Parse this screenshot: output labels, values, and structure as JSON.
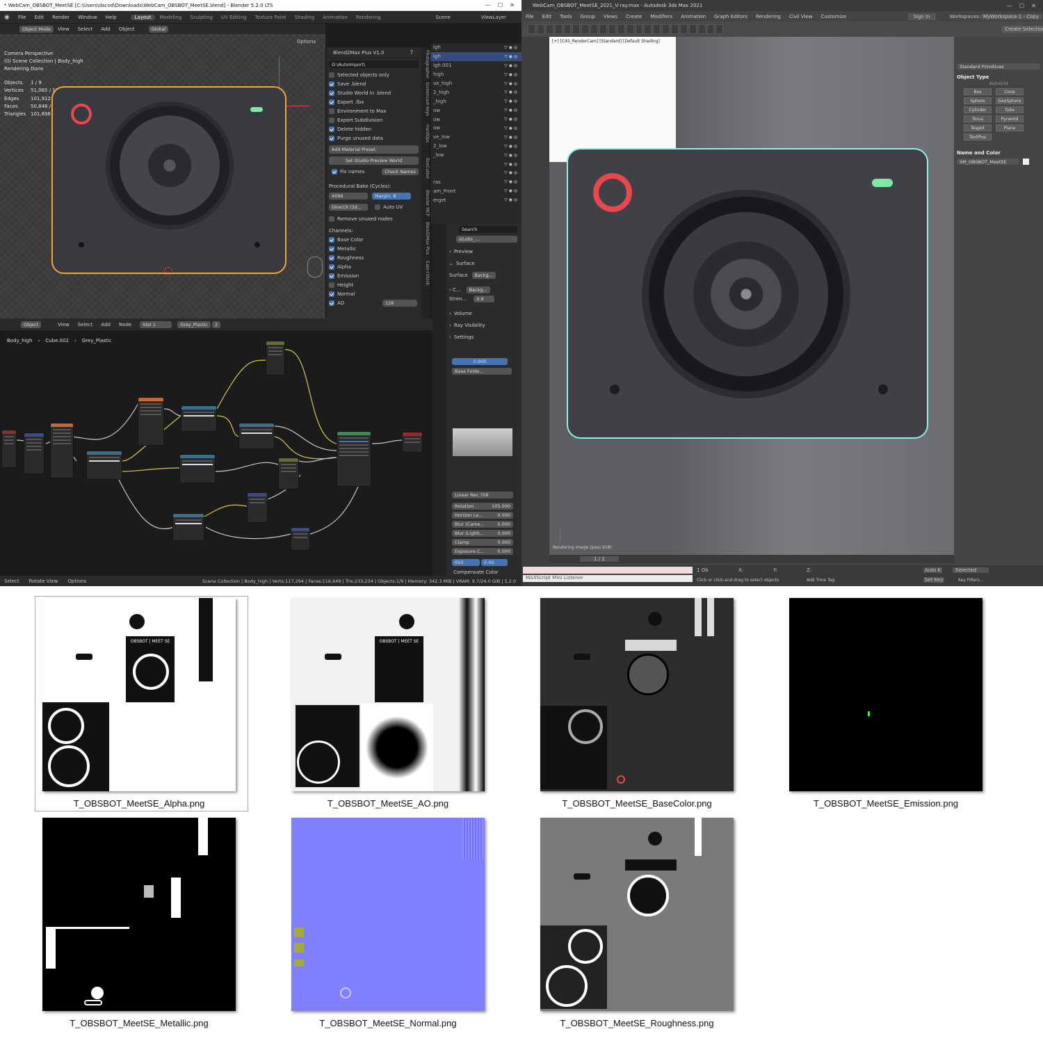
{
  "blender": {
    "title": "* WebCam_OBSBOT_MeetSE [C:\\Users\\dacod\\Downloads\\WebCam_OBSBOT_MeetSE.blend] - Blender 5.2.0 LTS",
    "menu": [
      "File",
      "Edit",
      "Render",
      "Window",
      "Help"
    ],
    "workspaces": [
      "Layout",
      "Modeling",
      "Sculpting",
      "UV Editing",
      "Texture Paint",
      "Shading",
      "Animation",
      "Rendering"
    ],
    "active_workspace": "Layout",
    "scene": "Scene",
    "view_layer": "ViewLayer",
    "header": {
      "mode": "Object Mode",
      "view": "View",
      "select": "Select",
      "add": "Add",
      "object": "Object",
      "orientation": "Global",
      "options": "Options"
    },
    "overlay": {
      "cam": "Camera Perspective",
      "collection": "(0) Scene Collection | Body_high",
      "status": "Rendering Done"
    },
    "stats": [
      {
        "k": "Objects",
        "v": "1 / 9"
      },
      {
        "k": "Vertices",
        "v": "51,065 / 117,294"
      },
      {
        "k": "Edges",
        "v": "101,912 / 233,919"
      },
      {
        "k": "Faces",
        "v": "50,848 / 116,649"
      },
      {
        "k": "Triangles",
        "v": "101,696 / 233,234"
      }
    ],
    "addon": {
      "title": "Blend2Max Plus V1.0",
      "path": "D:\\AutoImport\\",
      "options": [
        {
          "l": "Selected objects only",
          "c": false
        },
        {
          "l": "Save .blend",
          "c": true
        },
        {
          "l": "Studio World in .blend",
          "c": true
        },
        {
          "l": "Export .fbx",
          "c": true
        },
        {
          "l": "Environment to Max",
          "c": false
        },
        {
          "l": "Export Subdivision",
          "c": false
        },
        {
          "l": "Delete hidden",
          "c": true
        },
        {
          "l": "Purge unused data",
          "c": true
        }
      ],
      "add_preset": "Add Material Preset",
      "studio_btn": "Set Studio Preview World",
      "fix_names": "Fix names",
      "check_names": "Check Names",
      "bake_title": "Procedural Bake (Cycles):",
      "res": "4096",
      "margin_label": "Margin",
      "margin": "8",
      "normal_fmt": "DirectX (3d...",
      "auto_uv": "Auto UV",
      "remove_nodes": "Remove unused nodes",
      "channels_title": "Channels:",
      "channels": [
        {
          "l": "Base Color",
          "c": true
        },
        {
          "l": "Metallic",
          "c": true
        },
        {
          "l": "Roughness",
          "c": true
        },
        {
          "l": "Alpha",
          "c": true
        },
        {
          "l": "Emission",
          "c": true
        },
        {
          "l": "Height",
          "c": false
        },
        {
          "l": "Normal",
          "c": true
        },
        {
          "l": "AO",
          "c": true
        }
      ],
      "ao_samples": "128"
    },
    "side_tabs": [
      "Photographer",
      "Screencast Keys",
      "HardOps",
      "BoxCutter",
      "Blender MCP",
      "Blend2Max Plus",
      "Cam+Stock"
    ],
    "outliner": [
      "igh",
      "igh",
      "igh.001",
      "high",
      "ve_high",
      "2_high",
      "_high",
      "ow",
      "ow",
      "ow",
      "ve_low",
      "2_low",
      "_low",
      "",
      "",
      "ras",
      "am_Front",
      "erget"
    ],
    "node_header": {
      "object": "Object",
      "view": "View",
      "select": "Select",
      "add": "Add",
      "node": "Node",
      "slot": "Slot 1",
      "material": "Grey_Plastic",
      "users": "2"
    },
    "node_breadcrumb": [
      "Body_high",
      "Cube.002",
      "Grey_Plastic"
    ],
    "world": {
      "search": "Search",
      "name": "studio_...",
      "sections": [
        "Preview",
        "Surface"
      ],
      "surface_label": "Surface",
      "surface_val": "Backg...",
      "color_val": "Backg...",
      "strength_label": "Stren...",
      "strength": "0.9",
      "volume": "Volume",
      "ray": "Ray Visibility",
      "settings": "Settings",
      "hdri_val": "0.900",
      "folder": "Base Folde...",
      "view_transform": "Linear Rec.709",
      "params": [
        {
          "k": "Rotation",
          "v": "105.000"
        },
        {
          "k": "Horizon Le...",
          "v": "0.000"
        },
        {
          "k": "Blur (Came...",
          "v": "0.000"
        },
        {
          "k": "Blur (Lighti...",
          "v": "0.000"
        },
        {
          "k": "Clamp",
          "v": "0.000"
        },
        {
          "k": "Exposure C...",
          "v": "0.000"
        }
      ],
      "temp": "650",
      "temp2": "0.00",
      "comp": "Compensate Color"
    },
    "status": {
      "select": "Select",
      "rotate": "Rotate View",
      "options": "Options",
      "info": "Scene Collection | Body_high | Verts:117,294 | Faces:116,649 | Tris:233,234 | Objects:1/9 | Memory: 342.3 MiB | VRAM: 9.7/24.0 GiB | 5.2.0"
    }
  },
  "max": {
    "title": "WebCam_OBSBOT_MeetSE_2021_V-ray.max - Autodesk 3ds Max 2021",
    "menu": [
      "File",
      "Edit",
      "Tools",
      "Group",
      "Views",
      "Create",
      "Modifiers",
      "Animation",
      "Graph Editors",
      "Rendering",
      "Civil View",
      "Customize"
    ],
    "sign_in": "Sign In",
    "workspace": "Workspaces:",
    "workspace_val": "MyWorkspace-1 - Copy",
    "selset": "Create Selection Se",
    "viewport_label": "[+] [C4S_RenderCam] [Standard] [Default Shading]",
    "render_progress": "Rendering image (pass 918)",
    "panel": {
      "dropdown": "Standard Primitives",
      "obj_type": "Object Type",
      "autogrid": "AutoGrid",
      "prims": [
        "Box",
        "Cone",
        "Sphere",
        "GeoSphere",
        "Cylinder",
        "Tube",
        "Torus",
        "Pyramid",
        "Teapot",
        "Plane",
        "TextPlus"
      ],
      "name_color": "Name and Color",
      "name": "SM_OBSBOT_MeetSE"
    },
    "timeline": "1 / 2",
    "status": {
      "listener": "MAXScript Mini Listener",
      "sel": "1 Ob",
      "hint": "Click or click-and-drag to select objects",
      "tag": "Add Time Tag",
      "x": "X:",
      "y": "Y:",
      "z": "Z:",
      "autok": "Auto K",
      "setk": "Set Key",
      "selected": "Selected",
      "filters": "Key Filters..."
    }
  },
  "textures": [
    {
      "name": "T_OBSBOT_MeetSE_Alpha.png",
      "kind": "alpha"
    },
    {
      "name": "T_OBSBOT_MeetSE_AO.png",
      "kind": "ao"
    },
    {
      "name": "T_OBSBOT_MeetSE_BaseColor.png",
      "kind": "base"
    },
    {
      "name": "T_OBSBOT_MeetSE_Emission.png",
      "kind": "emission"
    },
    {
      "name": "T_OBSBOT_MeetSE_Metallic.png",
      "kind": "metallic"
    },
    {
      "name": "T_OBSBOT_MeetSE_Normal.png",
      "kind": "normal"
    },
    {
      "name": "T_OBSBOT_MeetSE_Roughness.png",
      "kind": "rough"
    }
  ],
  "texture_labels": {
    "logo": "OBSBOT | MEET SE"
  },
  "colors": {
    "accent": "#4772b3",
    "ring": "#e8474e",
    "led": "#7ee8a7",
    "select": "#f4a43a",
    "normal": "#8080ff"
  }
}
